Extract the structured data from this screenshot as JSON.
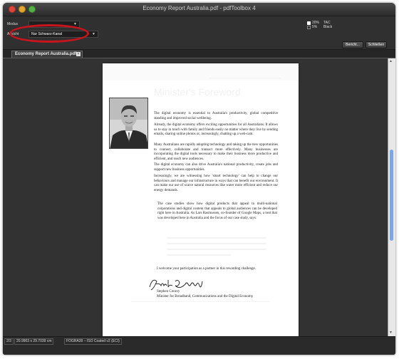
{
  "window": {
    "title": "Economy Report Australia.pdf - pdfToolbox 4"
  },
  "toolbar": {
    "modus_label": "Modus",
    "modus_value": "",
    "ansicht_label": "Ansicht",
    "ansicht_value": "Nur Schwarz-Kanal",
    "legend": [
      {
        "label": "20%",
        "desc": "TAC",
        "checked": true
      },
      {
        "label": "5%",
        "desc": "Black",
        "checked": false
      }
    ],
    "buttons": {
      "report": "Bericht...",
      "close": "Schließen"
    }
  },
  "tabs": [
    {
      "label": "Economy Report Australia.pdf",
      "close": "×"
    }
  ],
  "document": {
    "heading": "Minister's Foreword",
    "paragraphs": [
      "The digital economy is essential to Australia's productivity, global competitive standing and improved social wellbeing.",
      "Already, the digital economy offers exciting opportunities for all Australians. It allows us to stay in touch with family and friends easily no matter where they live by sending emails, sharing online photos or, increasingly, chatting up a web-cam.",
      "Many Australians are rapidly adopting technology and taking up the new opportunities to connect, collaborate and transact more effectively. Many businesses are incorporating the digital tools necessary to make their business more productive and efficient, and reach new audiences.",
      "The digital economy can also drive Australia's national productivity, create jobs and support new business opportunities.",
      "Increasingly, we are witnessing how 'smart technology' can help to change our behaviours and manage our infrastructure in ways that can benefit our environment. It can make our use of scarce natural resources like water more efficient and reduce our energy demands."
    ],
    "case_study": "The case studies show how digital products that appeal to multi-national corporations and digital content that appeals to global audiences can be developed right here in Australia. As Lars Rasmussen, co-founder of Google Maps, a tool that was developed here in Australia and the focus of our case study, says:",
    "closing": "I welcome your participation as a partner in this rewarding challenge.",
    "signature_name": "Stephen Conroy",
    "signature_title": "Minister for Broadband, Communications and the Digital Economy"
  },
  "status": {
    "page": "2/3",
    "size": "20.9903 x 29.7039 cm",
    "profile": "FOGRA39 – ISO Coated v2 (ECI)"
  },
  "colors": {
    "annotation": "#c8141c",
    "scroll_thumb": "#7aa7e6"
  }
}
